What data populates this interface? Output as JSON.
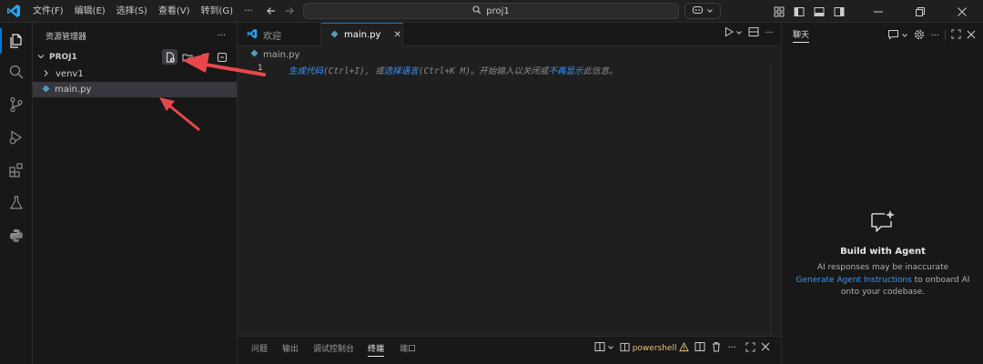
{
  "menu": [
    "文件(F)",
    "编辑(E)",
    "选择(S)",
    "查看(V)",
    "转到(G)",
    "···"
  ],
  "search": {
    "text": "proj1"
  },
  "sidebar": {
    "title": "资源管理器",
    "more": "···",
    "project": "PROJ1",
    "items": [
      {
        "label": "venv1",
        "kind": "folder"
      },
      {
        "label": "main.py",
        "kind": "file",
        "selected": true
      }
    ]
  },
  "tabs": [
    {
      "label": "欢迎",
      "active": false
    },
    {
      "label": "main.py",
      "active": true,
      "close": "✕"
    }
  ],
  "breadcrumb": {
    "file": "main.py"
  },
  "editor": {
    "line_number": "1",
    "hint_parts": [
      "生成代码",
      "(Ctrl+I), 或",
      "选择语言",
      "(Ctrl+K M)。开始输入以关闭或",
      "不再显示",
      "此信息。"
    ]
  },
  "panel": {
    "tabs": [
      "问题",
      "输出",
      "调试控制台",
      "终端",
      "端口"
    ],
    "active_tab": "终端",
    "terminal": "powershell"
  },
  "chat": {
    "title": "聊天",
    "heading": "Build with Agent",
    "line1": "AI responses may be inaccurate",
    "link": "Generate Agent Instructions",
    "line2_suffix": " to onboard AI",
    "line3": "onto your codebase."
  },
  "colors": {
    "accent": "#0078d4",
    "link": "#3794ff",
    "annotation_arrow": "#e8474c",
    "python_icon": "#519aba",
    "vscode_logo": "#23a9f2",
    "warning": "#e5c07b"
  }
}
